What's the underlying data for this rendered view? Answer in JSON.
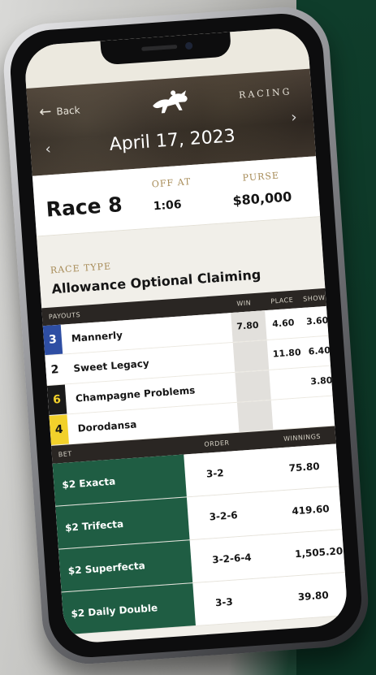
{
  "colors": {
    "brand_green": "#1f5d43",
    "gold_label": "#a68a55",
    "dark_header": "#2a2623",
    "post_3": "#2e4ea3",
    "post_6": "#1a1a1a",
    "post_4": "#f2d12b"
  },
  "header": {
    "back_label": "Back",
    "brand": "RACING",
    "logo_icon": "horse-jockey-icon",
    "date": "April 17, 2023"
  },
  "race": {
    "title": "Race 8",
    "off_at_label": "OFF AT",
    "off_at_value": "1:06",
    "purse_label": "PURSE",
    "purse_value": "$80,000",
    "race_type_label": "RACE TYPE",
    "race_type_value": "Allowance Optional Claiming"
  },
  "payouts": {
    "label": "PAYOUTS",
    "col_win": "WIN",
    "col_place": "PLACE",
    "col_show": "SHOW",
    "rows": [
      {
        "num": "3",
        "name": "Mannerly",
        "win": "7.80",
        "place": "4.60",
        "show": "3.60"
      },
      {
        "num": "2",
        "name": "Sweet Legacy",
        "win": "",
        "place": "11.80",
        "show": "6.40"
      },
      {
        "num": "6",
        "name": "Champagne Problems",
        "win": "",
        "place": "",
        "show": "3.80"
      },
      {
        "num": "4",
        "name": "Dorodansa",
        "win": "",
        "place": "",
        "show": ""
      }
    ]
  },
  "bets": {
    "label": "BET",
    "col_order": "ORDER",
    "col_winnings": "WINNINGS",
    "rows": [
      {
        "name": "$2 Exacta",
        "order": "3-2",
        "winnings": "75.80"
      },
      {
        "name": "$2 Trifecta",
        "order": "3-2-6",
        "winnings": "419.60"
      },
      {
        "name": "$2 Superfecta",
        "order": "3-2-6-4",
        "winnings": "1,505.20"
      },
      {
        "name": "$2 Daily Double",
        "order": "3-3",
        "winnings": "39.80"
      }
    ]
  }
}
